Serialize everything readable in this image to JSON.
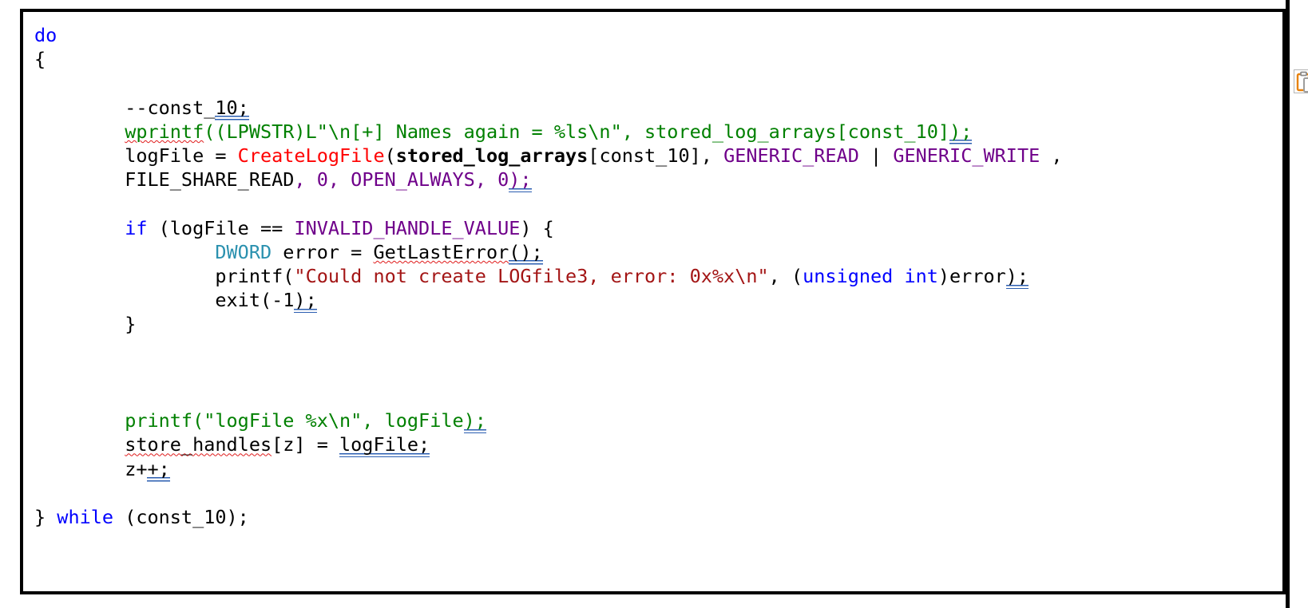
{
  "window": {
    "kind": "code-snippet-viewer",
    "background_color": "#ffffff",
    "frame_border_color": "#000000"
  },
  "palette": {
    "keyword_blue": "#0000ff",
    "type_teal": "#2b91af",
    "macro_purple": "#6f008a",
    "function_red": "#ff0000",
    "string_darkred": "#a31515",
    "string_green": "#008000",
    "plain_black": "#000000",
    "spellcheck_red": "#e01b1b",
    "grammar_blue": "#2a5db0",
    "icon_orange": "#e8820c",
    "icon_gray": "#9d9d9d"
  },
  "code": {
    "language": "c",
    "lines": [
      {
        "id": "l1",
        "indent": 0,
        "tokens": [
          {
            "t": "do",
            "c": "kw"
          }
        ]
      },
      {
        "id": "l2",
        "indent": 0,
        "tokens": [
          {
            "t": "{",
            "c": "plain"
          }
        ]
      },
      {
        "id": "l3",
        "indent": 0,
        "tokens": []
      },
      {
        "id": "l4",
        "indent": 1,
        "tokens": [
          {
            "t": "--const_",
            "c": "plain"
          },
          {
            "t": "10;",
            "c": "plain",
            "u": "blue"
          }
        ]
      },
      {
        "id": "l5",
        "indent": 1,
        "tokens": [
          {
            "t": "wprintf",
            "c": "green",
            "u": "redwave"
          },
          {
            "t": "((LPWSTR)L\"\\n[+] Names again = %ls\\n\", stored_log_arrays[const_10]",
            "c": "green"
          },
          {
            "t": ");",
            "c": "green",
            "u": "blue"
          }
        ]
      },
      {
        "id": "l6",
        "indent": 1,
        "tokens": [
          {
            "t": "logFile = ",
            "c": "plain"
          },
          {
            "t": "CreateLogFile",
            "c": "fn-red"
          },
          {
            "t": "(",
            "c": "plain"
          },
          {
            "t": "stored_log_arrays",
            "c": "plain bold"
          },
          {
            "t": "[const_10], ",
            "c": "plain"
          },
          {
            "t": "GENERIC_READ",
            "c": "macro"
          },
          {
            "t": " | ",
            "c": "plain"
          },
          {
            "t": "GENERIC_WRITE",
            "c": "macro"
          },
          {
            "t": " ,",
            "c": "plain"
          }
        ]
      },
      {
        "id": "l7",
        "indent": 1,
        "tokens": [
          {
            "t": "FILE_SHARE_READ",
            "c": "plain"
          },
          {
            "t": ", ",
            "c": "macro"
          },
          {
            "t": "0",
            "c": "macro"
          },
          {
            "t": ", ",
            "c": "macro"
          },
          {
            "t": "OPEN_ALWAYS",
            "c": "macro"
          },
          {
            "t": ", ",
            "c": "macro"
          },
          {
            "t": "0",
            "c": "macro"
          },
          {
            "t": ");",
            "c": "macro",
            "u": "blue"
          }
        ]
      },
      {
        "id": "l8",
        "indent": 0,
        "tokens": []
      },
      {
        "id": "l9",
        "indent": 1,
        "tokens": [
          {
            "t": "if",
            "c": "kw"
          },
          {
            "t": " (logFile == ",
            "c": "plain"
          },
          {
            "t": "INVALID_HANDLE_VALUE",
            "c": "macro"
          },
          {
            "t": ") {",
            "c": "plain"
          }
        ]
      },
      {
        "id": "l10",
        "indent": 2,
        "tokens": [
          {
            "t": "DWORD",
            "c": "type"
          },
          {
            "t": " error = ",
            "c": "plain"
          },
          {
            "t": "GetLastError",
            "c": "plain",
            "u": "redwave"
          },
          {
            "t": "();",
            "c": "plain",
            "u": "blue"
          }
        ]
      },
      {
        "id": "l11",
        "indent": 2,
        "tokens": [
          {
            "t": "printf(",
            "c": "plain"
          },
          {
            "t": "\"Could not create LOGfile3, error: 0x%x\\n\"",
            "c": "str-dark"
          },
          {
            "t": ", (",
            "c": "plain"
          },
          {
            "t": "unsigned int",
            "c": "kw"
          },
          {
            "t": ")error",
            "c": "plain"
          },
          {
            "t": ");",
            "c": "plain",
            "u": "blue"
          }
        ]
      },
      {
        "id": "l12",
        "indent": 2,
        "tokens": [
          {
            "t": "exit(-1",
            "c": "plain"
          },
          {
            "t": ");",
            "c": "plain",
            "u": "blue"
          }
        ]
      },
      {
        "id": "l13",
        "indent": 1,
        "tokens": [
          {
            "t": "}",
            "c": "plain"
          }
        ]
      },
      {
        "id": "l14",
        "indent": 0,
        "tokens": []
      },
      {
        "id": "l15",
        "indent": 0,
        "tokens": []
      },
      {
        "id": "l16",
        "indent": 0,
        "tokens": []
      },
      {
        "id": "l17",
        "indent": 1,
        "tokens": [
          {
            "t": "printf(\"logFile %x\\n\", logFile",
            "c": "green"
          },
          {
            "t": ");",
            "c": "green",
            "u": "blue"
          }
        ]
      },
      {
        "id": "l18",
        "indent": 1,
        "tokens": [
          {
            "t": "store_handles",
            "c": "plain",
            "u": "redwave"
          },
          {
            "t": "[z] = ",
            "c": "plain"
          },
          {
            "t": "logFile;",
            "c": "plain",
            "u": "blue"
          }
        ]
      },
      {
        "id": "l19",
        "indent": 1,
        "tokens": [
          {
            "t": "z+",
            "c": "plain"
          },
          {
            "t": "+;",
            "c": "plain",
            "u": "blue"
          }
        ]
      },
      {
        "id": "l20",
        "indent": 0,
        "tokens": []
      },
      {
        "id": "l21",
        "indent": 0,
        "tokens": [
          {
            "t": "} ",
            "c": "plain"
          },
          {
            "t": "while",
            "c": "kw"
          },
          {
            "t": " (const_10);",
            "c": "plain"
          }
        ]
      }
    ]
  },
  "right_panel": {
    "divider": "vertical-black-rule",
    "paste_icon_label": "paste-clipboard-icon"
  }
}
